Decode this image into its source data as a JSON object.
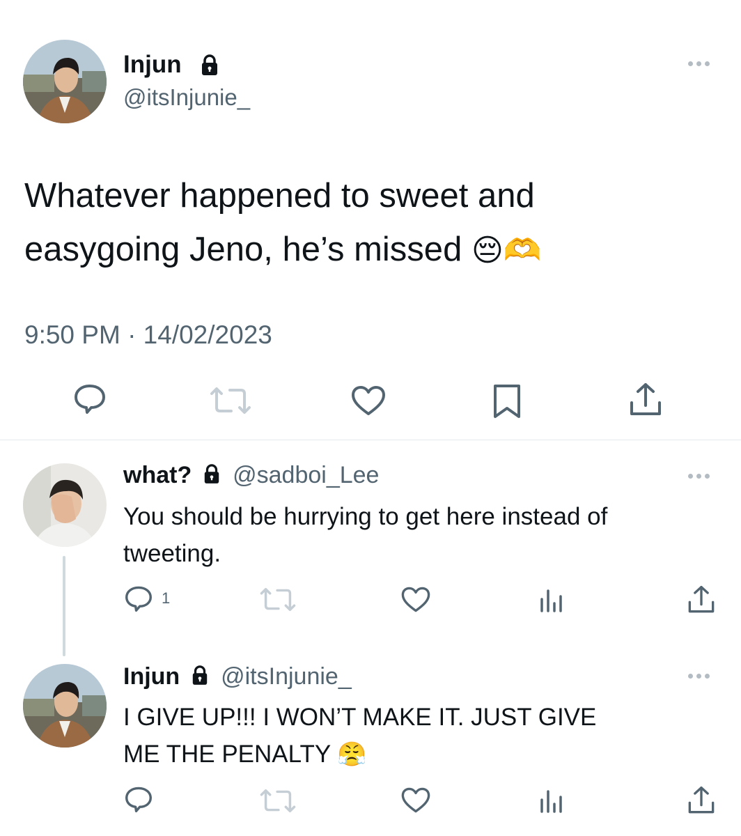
{
  "main_tweet": {
    "display_name": "Injun",
    "handle": "@itsInjunie_",
    "text_line1": "Whatever happened to sweet and",
    "text_line2": "easygoing Jeno, he’s missed",
    "emoji": "😔🫶",
    "timestamp": "9:50 PM · 14/02/2023",
    "actions": [
      "reply",
      "retweet",
      "like",
      "bookmark",
      "share"
    ]
  },
  "reply1": {
    "display_name": "what?",
    "handle": "@sadboi_Lee",
    "text_line1": "You should be hurrying to get here instead of",
    "text_line2": "tweeting.",
    "reply_count": "1"
  },
  "reply2": {
    "display_name": "Injun",
    "handle": "@itsInjunie_",
    "text_line1": "I GIVE UP!!! I WON’T MAKE IT. JUST GIVE",
    "text_line2": "ME THE PENALTY",
    "emoji": "😤"
  },
  "icons": [
    "lock-icon",
    "more-icon",
    "reply-icon",
    "retweet-icon",
    "like-icon",
    "bookmark-icon",
    "share-icon",
    "analytics-icon"
  ],
  "colors": {
    "text": "#0f1419",
    "secondary": "#536471",
    "icon": "#536471",
    "divider": "#e6e9ec"
  }
}
